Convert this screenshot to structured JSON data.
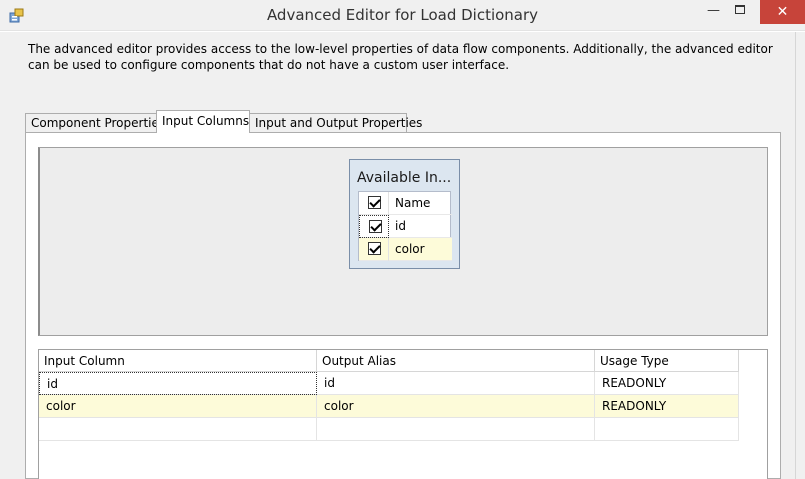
{
  "window": {
    "title": "Advanced Editor for Load Dictionary",
    "minimize_glyph": "—",
    "close_glyph": "✕"
  },
  "description": "The advanced editor provides access to the low-level properties of data flow components. Additionally, the advanced editor can be used to configure components that do not have a custom user interface.",
  "tabs": [
    {
      "label": "Component Properties",
      "active": false
    },
    {
      "label": "Input Columns",
      "active": true
    },
    {
      "label": "Input and Output Properties",
      "active": false
    }
  ],
  "available_inputs": {
    "title": "Available In...",
    "header": {
      "label": "Name",
      "checked": true
    },
    "rows": [
      {
        "name": "id",
        "checked": true
      },
      {
        "name": "color",
        "checked": true
      }
    ]
  },
  "columns_grid": {
    "headers": [
      "Input Column",
      "Output Alias",
      "Usage Type"
    ],
    "rows": [
      {
        "input_column": "id",
        "output_alias": "id",
        "usage_type": "READONLY"
      },
      {
        "input_column": "color",
        "output_alias": "color",
        "usage_type": "READONLY"
      }
    ]
  },
  "colors": {
    "highlight_row": "#fdfbd9",
    "close_button": "#c7443a",
    "available_box": "#dce6f0"
  },
  "icons": {
    "app": "editor-app-icon",
    "checkbox": "checkbox-checked-icon"
  }
}
